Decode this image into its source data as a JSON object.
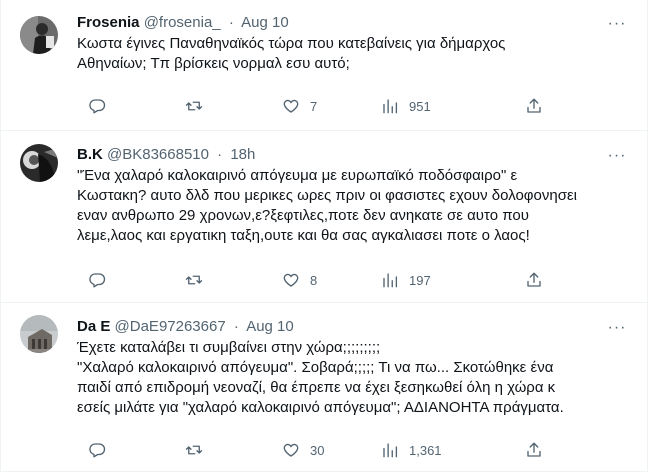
{
  "tweets": [
    {
      "name": "Frosenia",
      "handle": "@frosenia_",
      "separator": "·",
      "time": "Aug 10",
      "lines": [
        "Κωστα έγινες Παναθηναϊκός τώρα που κατεβαίνεις για δήμαρχος",
        "Αθηναίων; Τπ βρίσκεις νορμαλ εσυ αυτό;"
      ],
      "replies": "",
      "retweets": "",
      "likes": "7",
      "views": "951"
    },
    {
      "name": "B.K",
      "handle": "@BK83668510",
      "separator": "·",
      "time": "18h",
      "lines": [
        "\"Ένα χαλαρό καλοκαιρινό απόγευμα με ευρωπαϊκό ποδόσφαιρο\" ε",
        "Κωστακη? αυτο δλδ που μερικες ωρες πριν οι φασιστες εχουν δολοφονησει",
        "εναν ανθρωπο 29 χρονων,ε?ξεφτιλες,ποτε δεν ανηκατε σε αυτο που",
        "λεμε,λαος και εργατικη ταξη,ουτε και θα σας αγκαλιασει ποτε ο λαος!"
      ],
      "replies": "",
      "retweets": "",
      "likes": "8",
      "views": "197"
    },
    {
      "name": "Da E",
      "handle": "@DaE97263667",
      "separator": "·",
      "time": "Aug 10",
      "lines": [
        "Έχετε καταλάβει τι συμβαίνει στην χώρα;;;;;;;;;",
        "\"Χαλαρό καλοκαιρινό απόγευμα\". Σοβαρά;;;;; Τι να πω... Σκοτώθηκε ένα",
        "παιδί από επιδρομή νεοναζί, θα έπρεπε να έχει ξεσηκωθεί όλη η χώρα κ",
        "εσείς μιλάτε για \"χαλαρό καλοκαιρινό απόγευμα\"; ΑΔΙΑΝΟΗΤΑ πράγματα."
      ],
      "replies": "",
      "retweets": "",
      "likes": "30",
      "views": "1,361"
    }
  ],
  "icons": {
    "reply": "reply-icon",
    "retweet": "retweet-icon",
    "like": "heart-icon",
    "views": "views-icon",
    "share": "share-icon",
    "more": "more-icon"
  },
  "colors": {
    "text": "#0f1419",
    "secondary": "#536471",
    "divider": "#eff3f4"
  }
}
